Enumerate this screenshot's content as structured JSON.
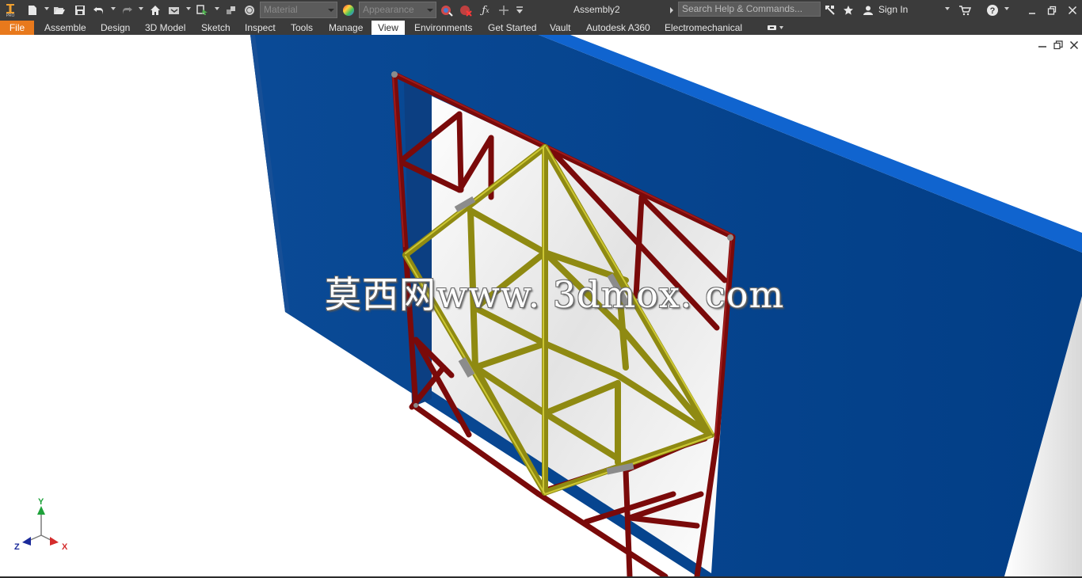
{
  "quick_access": {
    "material_placeholder": "Material",
    "appearance_placeholder": "Appearance",
    "document_title": "Assembly2",
    "search_placeholder": "Search Help & Commands...",
    "sign_in_label": "Sign In",
    "app_badge": "PRO",
    "icons": [
      "new-icon",
      "open-icon",
      "save-icon",
      "undo-icon",
      "redo-icon",
      "home-icon",
      "return-icon",
      "select-icon",
      "color-override-icon",
      "material-sphere-icon",
      "appearance-sphere-icon",
      "adjust-icon",
      "clear-icon",
      "fx-icon",
      "plus-icon",
      "customize-icon",
      "exchange-icon",
      "favorites-icon",
      "user-icon",
      "cart-icon",
      "help-icon",
      "minimize-icon",
      "restore-icon",
      "close-icon"
    ]
  },
  "ribbon": {
    "tabs": [
      {
        "label": "File"
      },
      {
        "label": "Assemble"
      },
      {
        "label": "Design"
      },
      {
        "label": "3D Model"
      },
      {
        "label": "Sketch"
      },
      {
        "label": "Inspect"
      },
      {
        "label": "Tools"
      },
      {
        "label": "Manage"
      },
      {
        "label": "View"
      },
      {
        "label": "Environments"
      },
      {
        "label": "Get Started"
      },
      {
        "label": "Vault"
      },
      {
        "label": "Autodesk A360"
      },
      {
        "label": "Electromechanical"
      }
    ],
    "active_tab": "View"
  },
  "viewport": {
    "watermark_text": "莫西网www. 3dmox. com",
    "triad": {
      "x_label": "X",
      "y_label": "Y",
      "z_label": "Z"
    }
  },
  "colors": {
    "title_bar": "#3b3b3b",
    "file_tab": "#e8791c",
    "wall_blue": "#023f87",
    "wall_top": "#1068d3",
    "frame_red": "#7a0a0a",
    "truss_yellow": "#8f8a12"
  }
}
